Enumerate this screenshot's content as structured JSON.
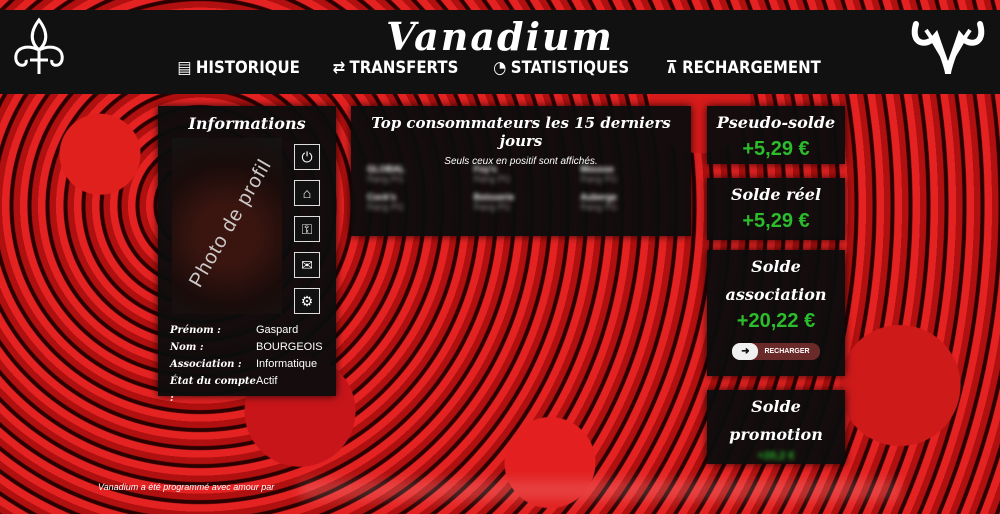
{
  "header": {
    "brand": "Vanadium",
    "nav": [
      {
        "label": "HISTORIQUE",
        "icon": "book-icon"
      },
      {
        "label": "TRANSFERTS",
        "icon": "transfer-arrows-icon"
      },
      {
        "label": "STATISTIQUES",
        "icon": "pie-chart-icon"
      },
      {
        "label": "RECHARGEMENT",
        "icon": "recharge-caret-icon"
      }
    ]
  },
  "info": {
    "title": "Informations",
    "photo_placeholder": "Photo de profil",
    "actions": [
      "power-icon",
      "home-icon",
      "key-icon",
      "envelope-icon",
      "gears-icon"
    ],
    "fields": [
      {
        "label": "Prénom :",
        "value": "Gaspard"
      },
      {
        "label": "Nom :",
        "value": "BOURGEOIS"
      },
      {
        "label": "Association :",
        "value": "Informatique"
      },
      {
        "label": "État du compte :",
        "value": "Actif"
      }
    ]
  },
  "top": {
    "title": "Top consommateurs les 15 derniers jours",
    "subtitle": "Seuls ceux en positif sont affichés.",
    "entries": [
      {
        "name": "GLOBAL",
        "rank": "Rang PG"
      },
      {
        "name": "Foy's",
        "rank": "Rang PG"
      },
      {
        "name": "Mousse",
        "rank": "Rang PG"
      },
      {
        "name": "Cock's",
        "rank": "Rang PG"
      },
      {
        "name": "Boisserie",
        "rank": "Rang PG"
      },
      {
        "name": "Auberge",
        "rank": "Rang PG"
      }
    ]
  },
  "balances": {
    "pseudo": {
      "title": "Pseudo-solde",
      "amount": "+5,29 €"
    },
    "reel": {
      "title": "Solde réel",
      "amount": "+5,29 €"
    },
    "association": {
      "title_line1": "Solde",
      "title_line2": "association",
      "amount": "+20,22 €",
      "button": "RECHARGER"
    },
    "promotion": {
      "title_line1": "Solde",
      "title_line2": "promotion",
      "amount": "+20,2 €"
    }
  },
  "footer": {
    "text": "Vanadium a été programmé avec amour par"
  },
  "colors": {
    "accent_green": "#2bbd2b",
    "panel": "#0c0c0c",
    "background_red": "#c7151a"
  }
}
